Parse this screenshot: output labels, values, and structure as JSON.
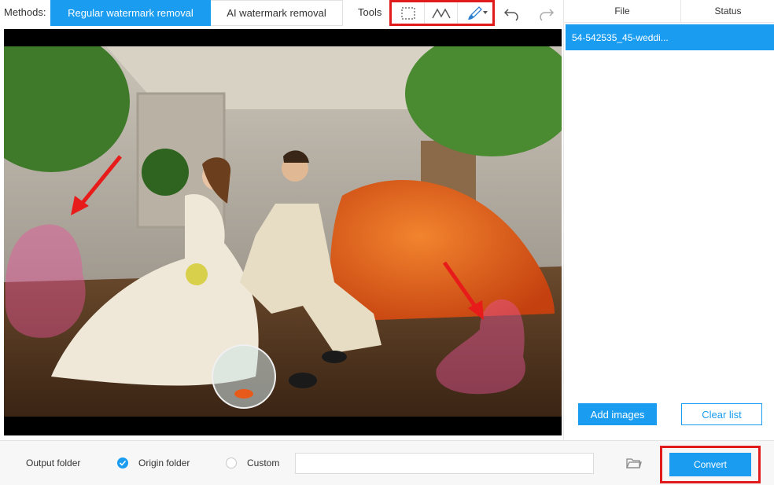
{
  "toolbar": {
    "methods_label": "Methods:",
    "method_tabs": [
      {
        "label": "Regular watermark removal",
        "active": true
      },
      {
        "label": "AI watermark removal",
        "active": false
      }
    ],
    "tools_label": "Tools",
    "tools": [
      "rectangle-select-icon",
      "polygonal-lasso-icon",
      "brush-icon"
    ],
    "undo_icon": "undo-icon",
    "redo_icon": "redo-icon"
  },
  "file_list": {
    "columns": [
      "File",
      "Status"
    ],
    "files": [
      {
        "name": "54-542535_45-weddi...",
        "status": ""
      }
    ],
    "add_label": "Add images",
    "clear_label": "Clear list"
  },
  "output": {
    "label": "Output folder",
    "options": [
      {
        "label": "Origin folder",
        "checked": true
      },
      {
        "label": "Custom",
        "checked": false
      }
    ],
    "path_value": "",
    "browse_icon": "folder-icon"
  },
  "convert_label": "Convert",
  "colors": {
    "accent": "#1a9cf0",
    "highlight_border": "#e01b1b",
    "mask": "#e8549a"
  }
}
